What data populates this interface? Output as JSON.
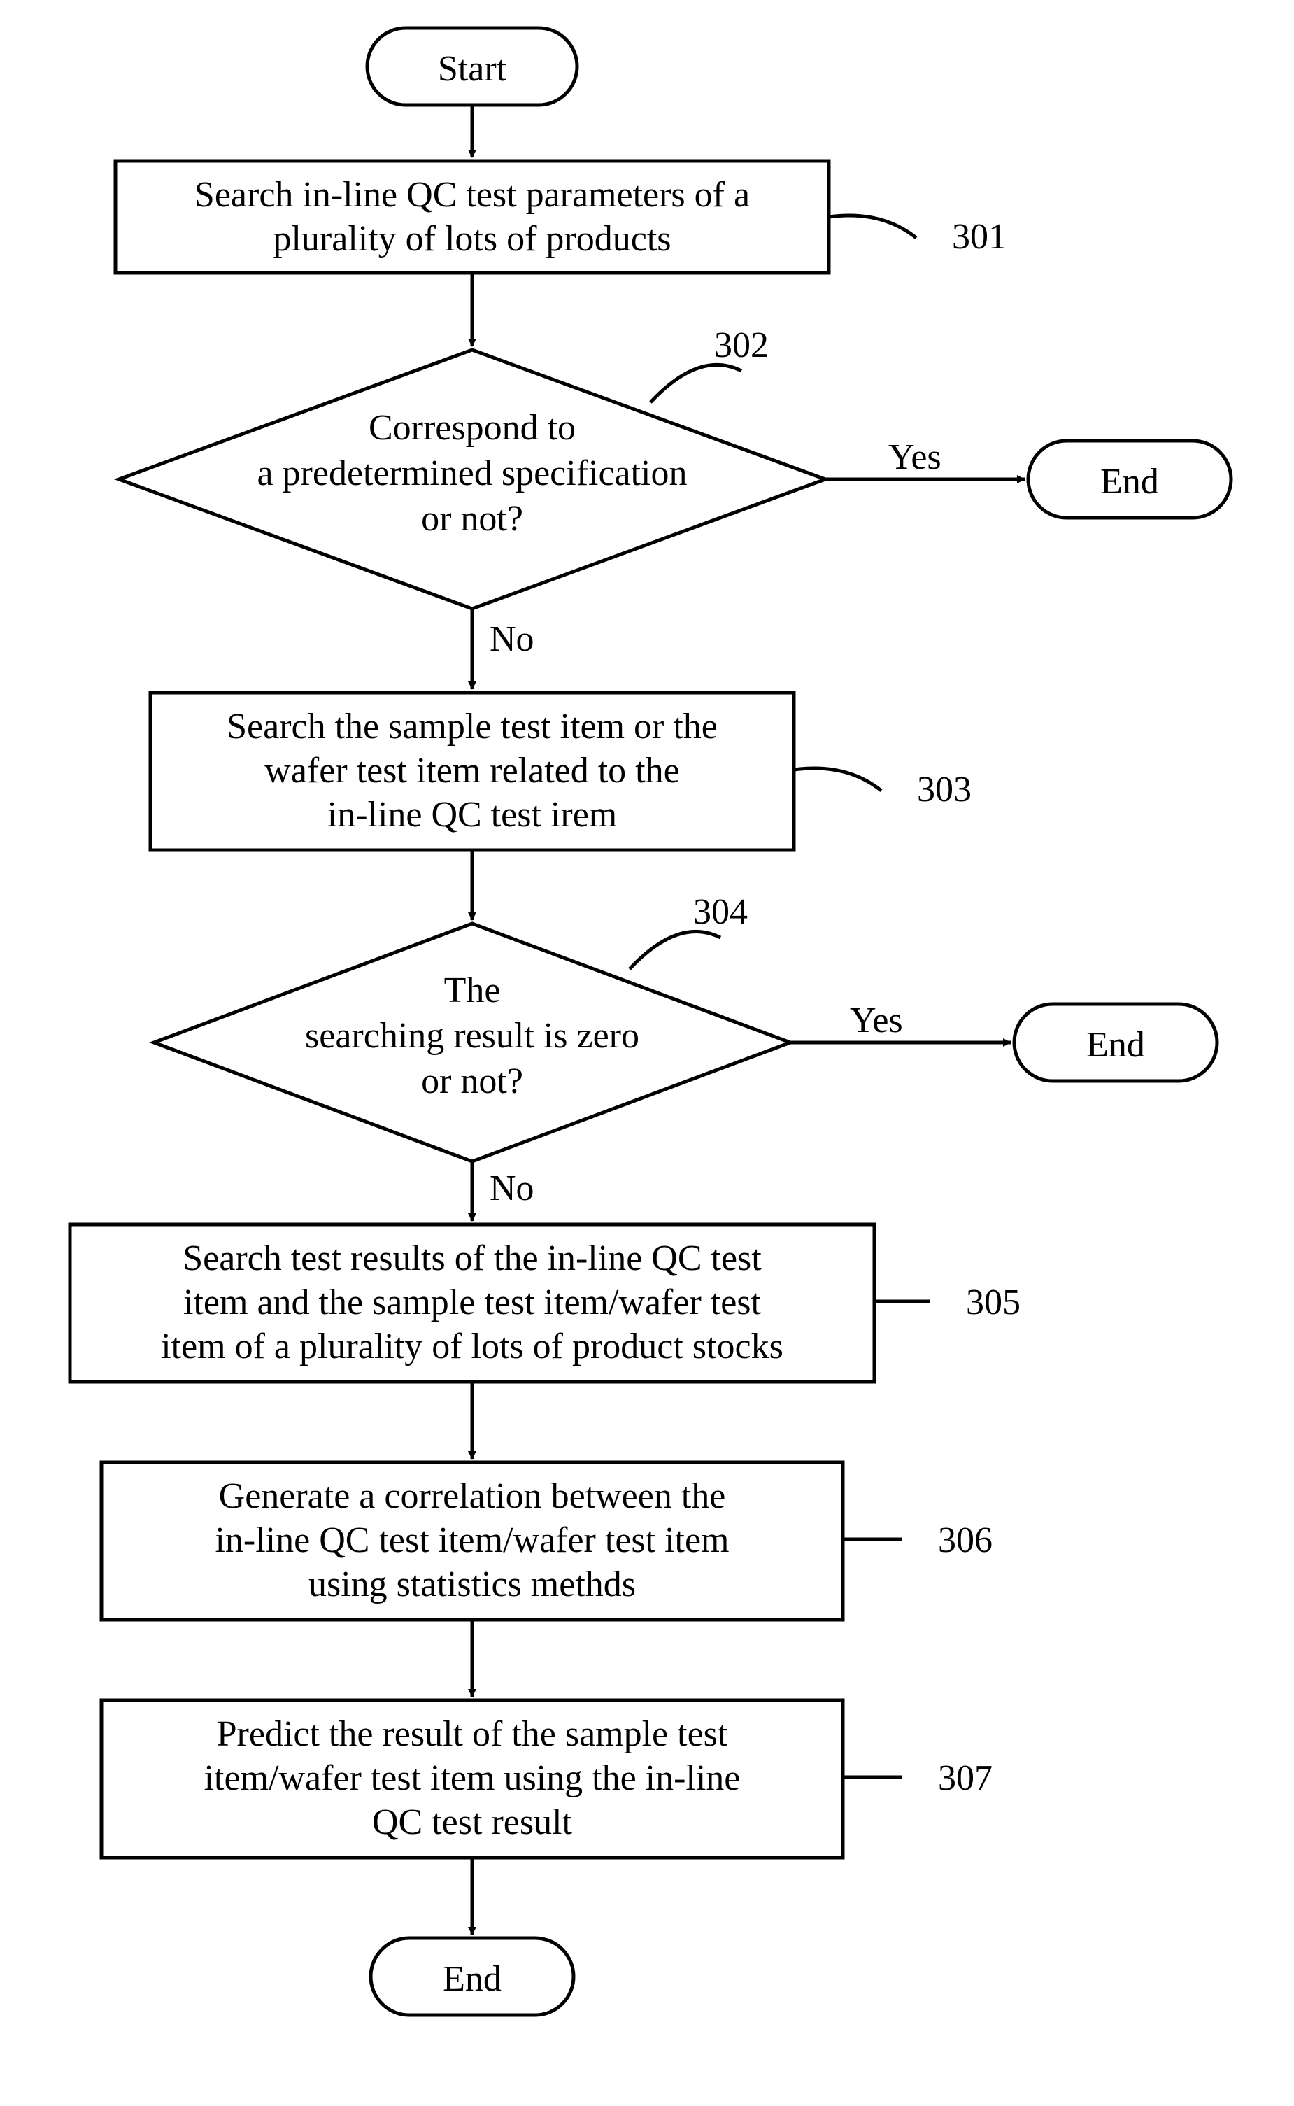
{
  "start": "Start",
  "step301": {
    "line1": "Search in-line QC test parameters of a",
    "line2": "plurality of lots of products",
    "ref": "301"
  },
  "dec302": {
    "line1": "Correspond to",
    "line2": "a predetermined specification",
    "line3": "or not?",
    "ref": "302",
    "yes": "Yes",
    "no": "No"
  },
  "end302": "End",
  "step303": {
    "line1": "Search the sample test item or the",
    "line2": "wafer test item related to the",
    "line3": "in-line QC test irem",
    "ref": "303"
  },
  "dec304": {
    "line1": "The",
    "line2": "searching result is zero",
    "line3": "or not?",
    "ref": "304",
    "yes": "Yes",
    "no": "No"
  },
  "end304": "End",
  "step305": {
    "line1": "Search test results of the in-line QC test",
    "line2": "item and the sample test item/wafer test",
    "line3": "item of a plurality of lots of product stocks",
    "ref": "305"
  },
  "step306": {
    "line1": "Generate a correlation between the",
    "line2": "in-line QC test item/wafer test item",
    "line3": "using statistics methds",
    "ref": "306"
  },
  "step307": {
    "line1": "Predict the result of the sample test",
    "line2": "item/wafer test item using the in-line",
    "line3": "QC test result",
    "ref": "307"
  },
  "endFinal": "End"
}
